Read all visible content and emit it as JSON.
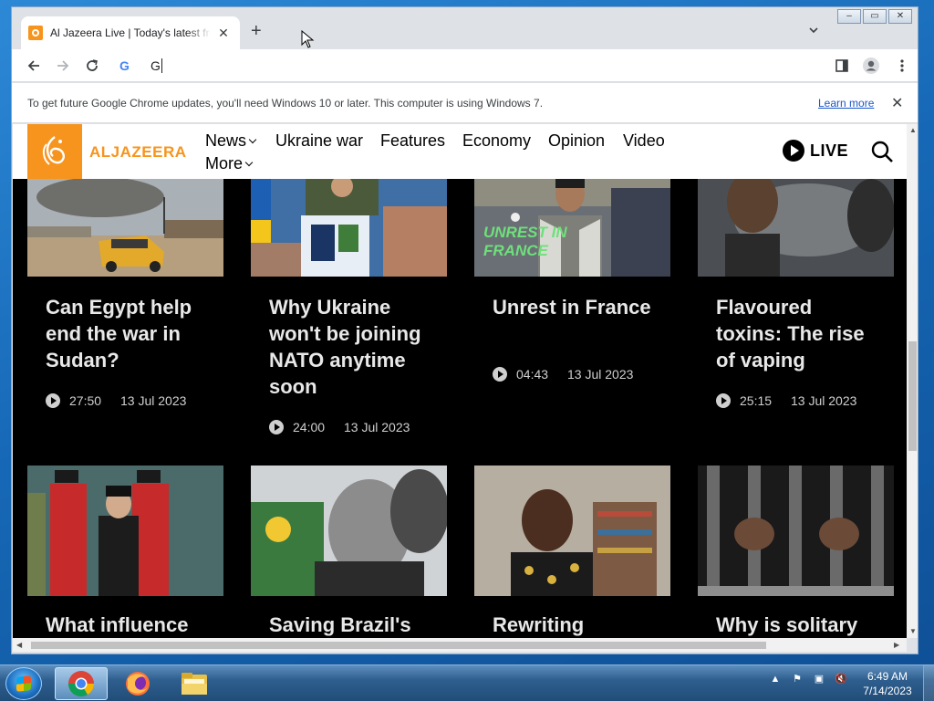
{
  "browser": {
    "tab_title": "Al Jazeera Live | Today's latest from Al Jazeera",
    "omnibox_value": "G",
    "infobar_message": "To get future Google Chrome updates, you'll need Windows 10 or later. This computer is using Windows 7.",
    "learn_more_label": "Learn more"
  },
  "site": {
    "brand": "ALJAZEERA",
    "brand_color": "#f7941d",
    "nav": [
      "News",
      "Ukraine war",
      "Features",
      "Economy",
      "Opinion",
      "Video",
      "More"
    ],
    "live_label": "LIVE"
  },
  "cards": [
    {
      "title": "Can Egypt help end the war in Sudan?",
      "duration": "27:50",
      "date": "13 Jul 2023"
    },
    {
      "title": "Why Ukraine won't be joining NATO anytime soon",
      "duration": "24:00",
      "date": "13 Jul 2023"
    },
    {
      "title": "Unrest in France",
      "duration": "04:43",
      "date": "13 Jul 2023",
      "thumb_text": "UNREST IN FRANCE"
    },
    {
      "title": "Flavoured toxins: The rise of vaping",
      "duration": "25:15",
      "date": "13 Jul 2023"
    },
    {
      "title": "What influence"
    },
    {
      "title": "Saving Brazil's"
    },
    {
      "title": "Rewriting"
    },
    {
      "title": "Why is solitary"
    }
  ],
  "taskbar": {
    "time": "6:49 AM",
    "date": "7/14/2023"
  }
}
